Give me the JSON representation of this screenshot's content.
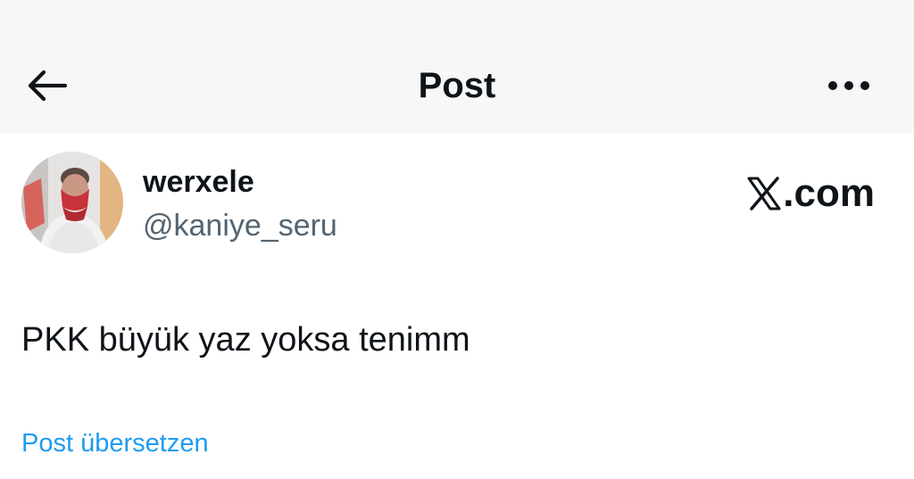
{
  "header": {
    "title": "Post",
    "back_icon": "arrow-left-icon",
    "more_icon": "more-horizontal-icon"
  },
  "author": {
    "display_name": "werxele",
    "handle": "@kaniye_seru",
    "avatar_icon": "user-avatar"
  },
  "watermark": {
    "text": ".com",
    "logo_icon": "x-logo-icon"
  },
  "post": {
    "text": "PKK büyük yaz yoksa tenimm"
  },
  "translate": {
    "label": "Post übersetzen"
  },
  "colors": {
    "text_primary": "#0f1419",
    "text_secondary": "#536471",
    "link": "#1d9bf0",
    "header_bg": "#f7f7f7"
  }
}
